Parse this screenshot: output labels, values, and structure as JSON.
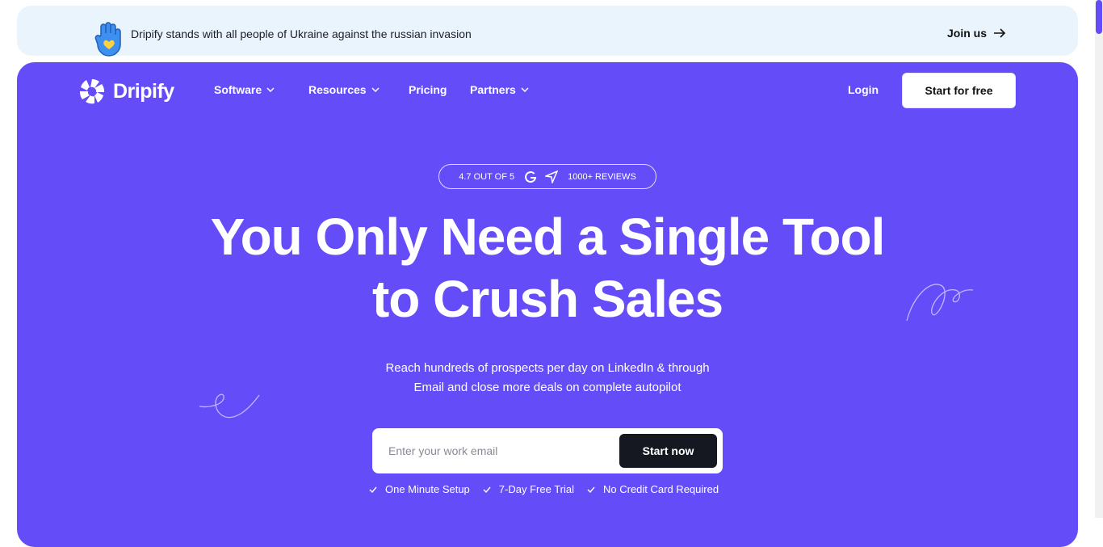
{
  "banner": {
    "message": "Dripify stands with all people of Ukraine against the russian invasion",
    "join_label": "Join us"
  },
  "brand": {
    "name": "Dripify"
  },
  "nav": {
    "items": [
      {
        "label": "Software",
        "has_dropdown": true
      },
      {
        "label": "Resources",
        "has_dropdown": true
      },
      {
        "label": "Pricing",
        "has_dropdown": false
      },
      {
        "label": "Partners",
        "has_dropdown": true
      }
    ],
    "login_label": "Login",
    "cta_label": "Start for free"
  },
  "rating": {
    "score_text": "4.7 OUT OF 5",
    "reviews_text": "1000+ REVIEWS",
    "icons": [
      "g2-icon",
      "capterra-icon"
    ]
  },
  "hero": {
    "headline_line1": "You Only Need a Single Tool",
    "headline_line2": "to Crush Sales",
    "sub_line1": "Reach hundreds of prospects per day on LinkedIn & through",
    "sub_line2": "Email and close more deals on complete autopilot"
  },
  "signup": {
    "email_placeholder": "Enter your work email",
    "button_label": "Start now"
  },
  "perks": [
    "One Minute Setup",
    "7-Day Free Trial",
    "No Credit Card Required"
  ],
  "colors": {
    "hero_bg": "#654cf9",
    "banner_bg": "#e9f4fc",
    "dark_button": "#151821"
  }
}
